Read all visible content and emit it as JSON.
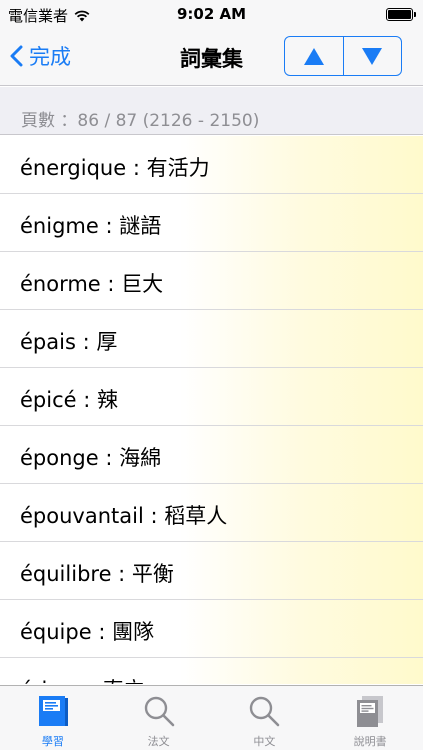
{
  "status_bar": {
    "carrier": "電信業者",
    "time": "9:02 AM"
  },
  "nav": {
    "back_label": "完成",
    "title": "詞彙集",
    "up_icon": "triangle-up-icon",
    "down_icon": "triangle-down-icon"
  },
  "page_info": "頁數 ：86 / 87 (2126 - 2150)",
  "entries": [
    "énergique : 有活力",
    "énigme : 謎語",
    "énorme : 巨大",
    "épais : 厚",
    "épicé : 辣",
    "éponge : 海綿",
    "épouvantail : 稻草人",
    "équilibre : 平衡",
    "équipe : 團隊",
    "ériger : 直立"
  ],
  "tabs": [
    {
      "label": "學習",
      "icon": "study-book-icon",
      "active": true
    },
    {
      "label": "法文",
      "icon": "search-icon",
      "active": false
    },
    {
      "label": "中文",
      "icon": "search-icon",
      "active": false
    },
    {
      "label": "說明書",
      "icon": "manual-icon",
      "active": false
    }
  ],
  "colors": {
    "accent": "#1a7cf5",
    "row_highlight": "#fffacc"
  }
}
